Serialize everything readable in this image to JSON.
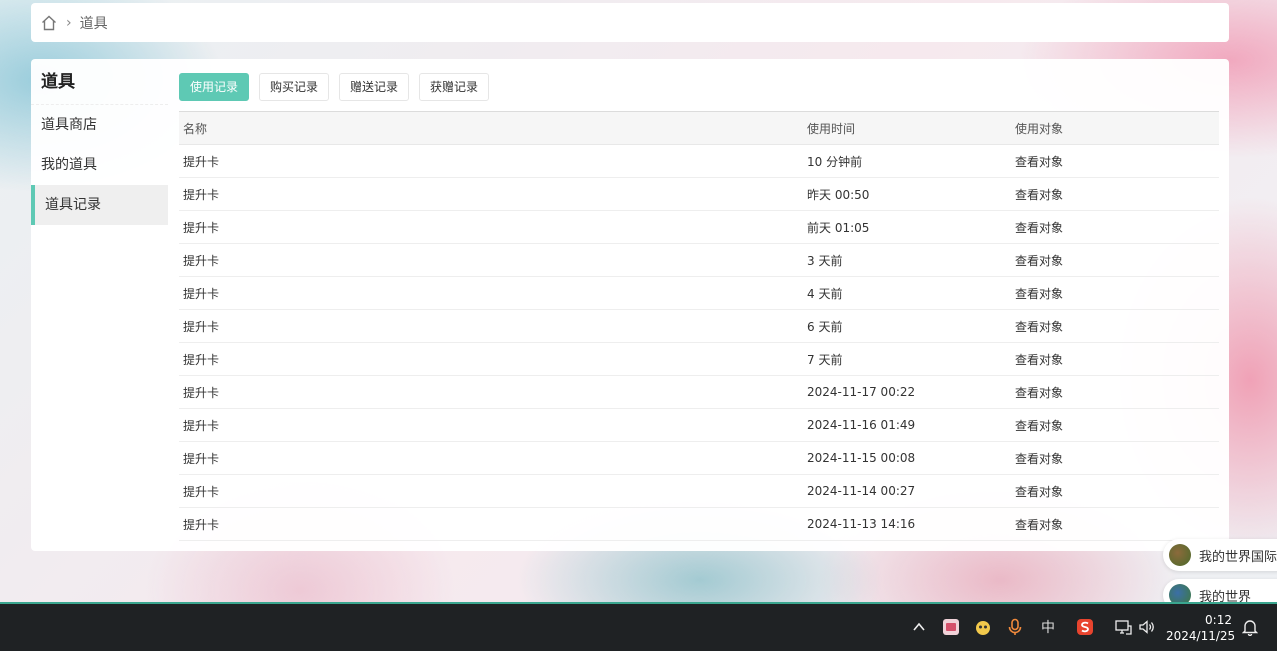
{
  "breadcrumb": {
    "current": "道具"
  },
  "sidebar": {
    "title": "道具",
    "items": [
      {
        "label": "道具商店"
      },
      {
        "label": "我的道具"
      },
      {
        "label": "道具记录"
      }
    ],
    "active_index": 2
  },
  "tabs": [
    {
      "label": "使用记录"
    },
    {
      "label": "购买记录"
    },
    {
      "label": "赠送记录"
    },
    {
      "label": "获赠记录"
    }
  ],
  "active_tab": 0,
  "table": {
    "columns": [
      "名称",
      "使用时间",
      "使用对象"
    ],
    "rows": [
      {
        "name": "提升卡",
        "time": "10 分钟前",
        "target": "查看对象"
      },
      {
        "name": "提升卡",
        "time": "昨天 00:50",
        "target": "查看对象"
      },
      {
        "name": "提升卡",
        "time": "前天 01:05",
        "target": "查看对象"
      },
      {
        "name": "提升卡",
        "time": "3 天前",
        "target": "查看对象"
      },
      {
        "name": "提升卡",
        "time": "4 天前",
        "target": "查看对象"
      },
      {
        "name": "提升卡",
        "time": "6 天前",
        "target": "查看对象"
      },
      {
        "name": "提升卡",
        "time": "7 天前",
        "target": "查看对象"
      },
      {
        "name": "提升卡",
        "time": "2024-11-17 00:22",
        "target": "查看对象"
      },
      {
        "name": "提升卡",
        "time": "2024-11-16 01:49",
        "target": "查看对象"
      },
      {
        "name": "提升卡",
        "time": "2024-11-15 00:08",
        "target": "查看对象"
      },
      {
        "name": "提升卡",
        "time": "2024-11-14 00:27",
        "target": "查看对象"
      },
      {
        "name": "提升卡",
        "time": "2024-11-13 14:16",
        "target": "查看对象"
      }
    ]
  },
  "floating_chips": [
    {
      "label": "我的世界国际"
    },
    {
      "label": "我的世界"
    }
  ],
  "taskbar": {
    "ime_label": "中",
    "clock_time": "0:12",
    "clock_date": "2024/11/25"
  },
  "colors": {
    "accent": "#5ec9b4",
    "taskbar": "#1f2224"
  }
}
